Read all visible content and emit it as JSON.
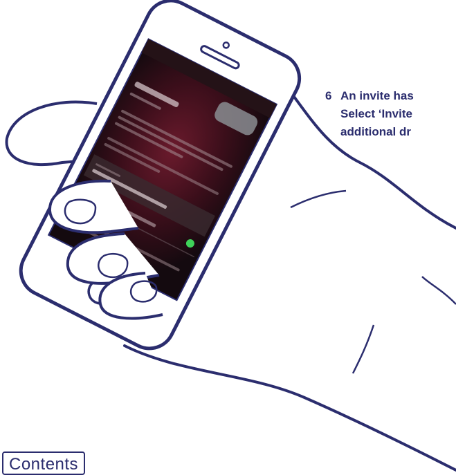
{
  "step": {
    "number": "6",
    "lines": [
      "An invite has",
      "Select ‘Invite",
      "additional dr"
    ]
  },
  "contents_button": {
    "label": "Contents"
  },
  "colors": {
    "ink": "#2b2d6e",
    "screen_dark": "#1a0f14",
    "screen_accent": "#5a1424",
    "toggle_on": "#3fd35a"
  },
  "icons": {
    "front_camera": "camera-icon",
    "speaker": "speaker-icon",
    "home_button": "home-button-icon"
  }
}
